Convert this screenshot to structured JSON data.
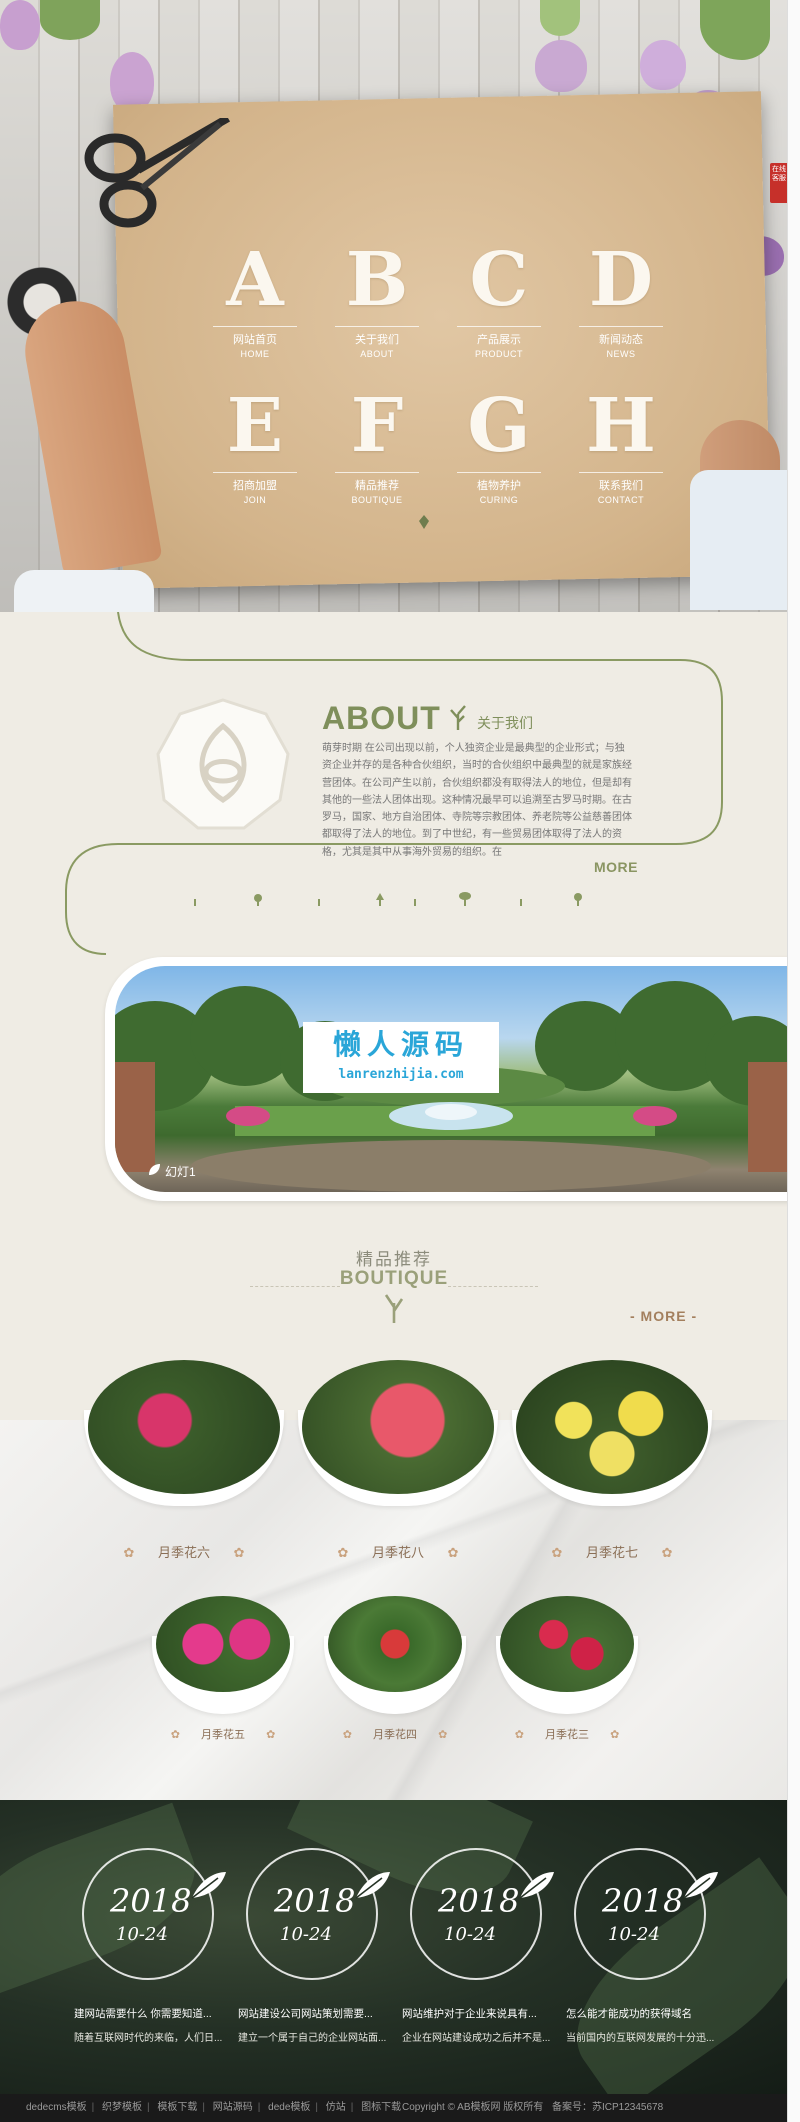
{
  "nav": {
    "items": [
      {
        "letter": "A",
        "cn": "网站首页",
        "en": "HOME"
      },
      {
        "letter": "B",
        "cn": "关于我们",
        "en": "ABOUT"
      },
      {
        "letter": "C",
        "cn": "产品展示",
        "en": "PRODUCT"
      },
      {
        "letter": "D",
        "cn": "新闻动态",
        "en": "NEWS"
      },
      {
        "letter": "E",
        "cn": "招商加盟",
        "en": "JOIN"
      },
      {
        "letter": "F",
        "cn": "精品推荐",
        "en": "BOUTIQUE"
      },
      {
        "letter": "G",
        "cn": "植物养护",
        "en": "CURING"
      },
      {
        "letter": "H",
        "cn": "联系我们",
        "en": "CONTACT"
      }
    ],
    "badge": "在线客服"
  },
  "about": {
    "title": "ABOUT",
    "subtitle": "关于我们",
    "text": "萌芽时期 在公司出现以前，个人独资企业是最典型的企业形式；与独资企业并存的是各种合伙组织，当时的合伙组织中最典型的就是家族经营团体。在公司产生以前，合伙组织都没有取得法人的地位，但是却有其他的一些法人团体出现。这种情况最早可以追溯至古罗马时期。在古罗马，国家、地方自治团体、寺院等宗教团体、养老院等公益慈善团体都取得了法人的地位。到了中世纪，有一些贸易团体取得了法人的资格，尤其是其中从事海外贸易的组织。在",
    "more": "MORE"
  },
  "slider": {
    "caption": "幻灯1",
    "watermark_cn": "懒人源码",
    "watermark_url": "lanrenzhijia.com"
  },
  "boutique": {
    "title_cn": "精品推荐",
    "title_en": "BOUTIQUE",
    "more": "- MORE -",
    "products": [
      {
        "name": "月季花六"
      },
      {
        "name": "月季花八"
      },
      {
        "name": "月季花七"
      },
      {
        "name": "月季花五"
      },
      {
        "name": "月季花四"
      },
      {
        "name": "月季花三"
      }
    ]
  },
  "news": {
    "items": [
      {
        "year": "2018",
        "date": "10-24",
        "title": "建网站需要什么 你需要知道...",
        "summary": "随着互联网时代的来临，人们日..."
      },
      {
        "year": "2018",
        "date": "10-24",
        "title": "网站建设公司网站策划需要...",
        "summary": "建立一个属于自己的企业网站面..."
      },
      {
        "year": "2018",
        "date": "10-24",
        "title": "网站维护对于企业来说具有...",
        "summary": "企业在网站建设成功之后并不是..."
      },
      {
        "year": "2018",
        "date": "10-24",
        "title": "怎么能才能成功的获得域名",
        "summary": "当前国内的互联网发展的十分迅..."
      }
    ]
  },
  "footer": {
    "links": [
      "dedecms模板",
      "织梦模板",
      "模板下载",
      "网站源码",
      "dede模板",
      "仿站",
      "图标下载"
    ],
    "copyright": "Copyright © AB模板网 版权所有",
    "icp": "备案号：苏ICP12345678"
  },
  "colors": {
    "accent": "#7f8f5b",
    "brown": "#8a6e55",
    "footer": "#1a1a1a"
  }
}
